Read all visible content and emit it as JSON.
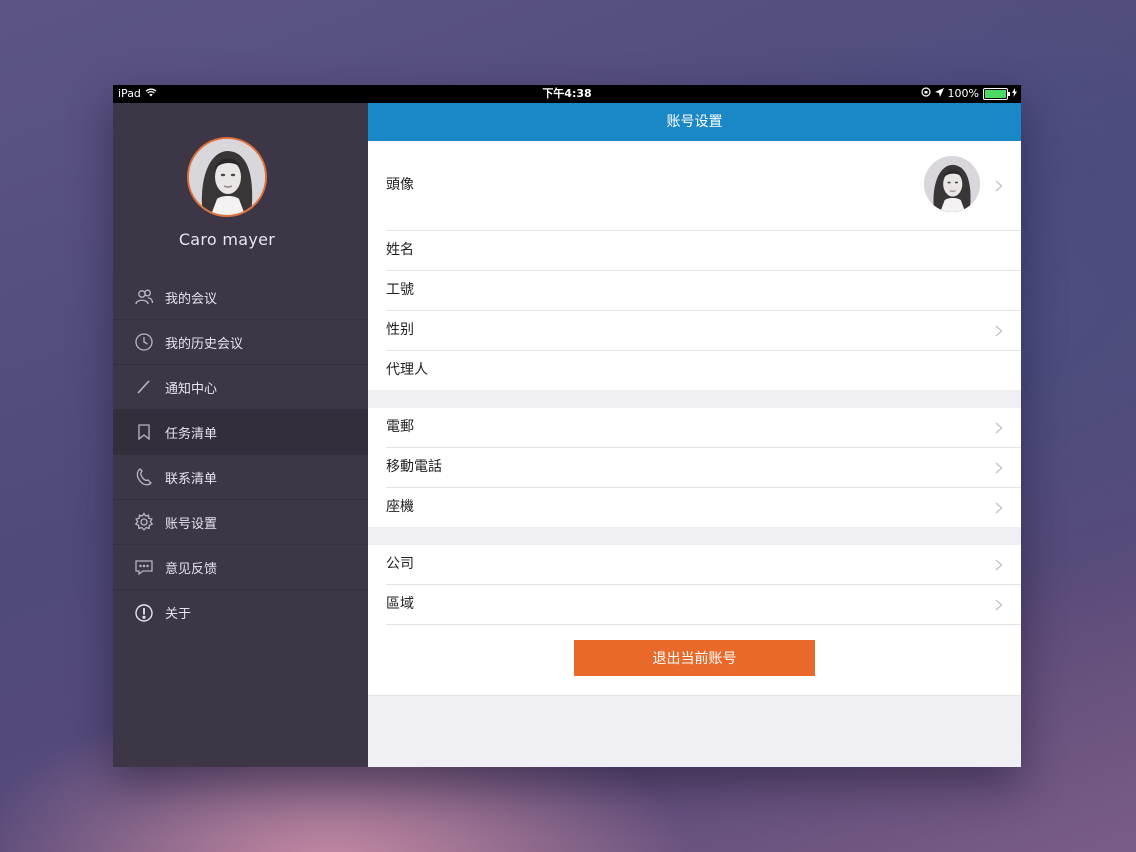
{
  "status_bar": {
    "device": "iPad",
    "time": "下午4:38",
    "battery": "100%",
    "battery_level": 1.0
  },
  "sidebar": {
    "username": "Caro mayer",
    "items": [
      {
        "label": "我的会议",
        "icon": "people-icon"
      },
      {
        "label": "我的历史会议",
        "icon": "clock-icon"
      },
      {
        "label": "通知中心",
        "icon": "pencil-icon"
      },
      {
        "label": "任务清单",
        "icon": "bookmark-icon",
        "active": true
      },
      {
        "label": "联系清单",
        "icon": "phone-icon"
      },
      {
        "label": "账号设置",
        "icon": "gear-icon"
      },
      {
        "label": "意见反馈",
        "icon": "chat-icon"
      },
      {
        "label": "关于",
        "icon": "info-icon"
      }
    ]
  },
  "main": {
    "title": "账号设置",
    "sections": [
      [
        {
          "label": "頭像"
        },
        {
          "label": "姓名"
        },
        {
          "label": "工號"
        },
        {
          "label": "性别"
        },
        {
          "label": "代理人"
        }
      ],
      [
        {
          "label": "電郵"
        },
        {
          "label": "移動電話"
        },
        {
          "label": "座機"
        }
      ],
      [
        {
          "label": "公司"
        },
        {
          "label": "區域"
        }
      ]
    ],
    "logout_label": "退出当前账号"
  },
  "colors": {
    "accent_blue": "#1a87c7",
    "sidebar_bg": "#3c3647",
    "logout_orange": "#e8692a",
    "avatar_border": "#e0703a"
  }
}
